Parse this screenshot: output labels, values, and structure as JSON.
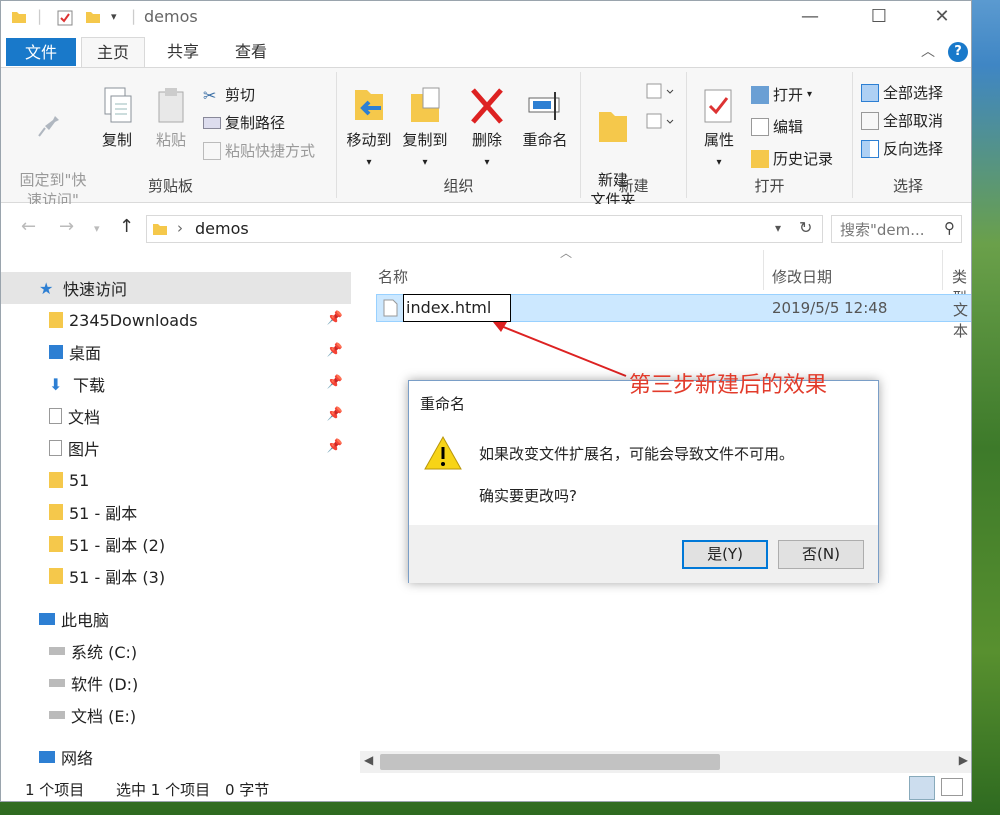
{
  "window": {
    "title": "demos",
    "controls": [
      "—",
      "☐",
      "✕"
    ]
  },
  "tabs": {
    "file": "文件",
    "home": "主页",
    "share": "共享",
    "view": "查看"
  },
  "ribbon": {
    "clipboard": {
      "label": "剪贴板",
      "pin": "固定到\"快\n速访问\"",
      "copy": "复制",
      "paste": "粘贴",
      "cut": "剪切",
      "copy_path": "复制路径",
      "paste_shortcut": "粘贴快捷方式"
    },
    "organize": {
      "label": "组织",
      "move_to": "移动到",
      "copy_to": "复制到",
      "delete": "删除",
      "rename": "重命名"
    },
    "new": {
      "label": "新建",
      "new_folder": "新建\n文件夹"
    },
    "open": {
      "label": "打开",
      "properties": "属性",
      "open": "打开",
      "edit": "编辑",
      "history": "历史记录"
    },
    "select": {
      "label": "选择",
      "select_all": "全部选择",
      "select_none": "全部取消",
      "invert": "反向选择"
    }
  },
  "address": {
    "path": "demos",
    "search_placeholder": "搜索\"dem..."
  },
  "sidebar": {
    "quick_access": "快速访问",
    "items": [
      "2345Downloads",
      "桌面",
      "下载",
      "文档",
      "图片",
      "51",
      "51 - 副本",
      "51 - 副本 (2)",
      "51 - 副本 (3)"
    ],
    "this_pc": "此电脑",
    "drives": [
      "系统 (C:)",
      "软件 (D:)",
      "文档 (E:)"
    ],
    "network": "网络"
  },
  "columns": {
    "name": "名称",
    "modified": "修改日期",
    "type": "类型"
  },
  "file": {
    "name": "index.html",
    "modified": "2019/5/5 12:48",
    "type": "文本"
  },
  "status": {
    "count": "1 个项目",
    "selected": "选中 1 个项目",
    "size": "0 字节"
  },
  "dialog": {
    "title": "重命名",
    "message": "如果改变文件扩展名，可能会导致文件不可用。",
    "question": "确实要更改吗?",
    "yes": "是(Y)",
    "no": "否(N)"
  },
  "annotation": "第三步新建后的效果",
  "colors": {
    "accent": "#1979ca",
    "selection": "#cce8ff",
    "annotation": "#e23b2b",
    "folder": "#f5c84b"
  }
}
